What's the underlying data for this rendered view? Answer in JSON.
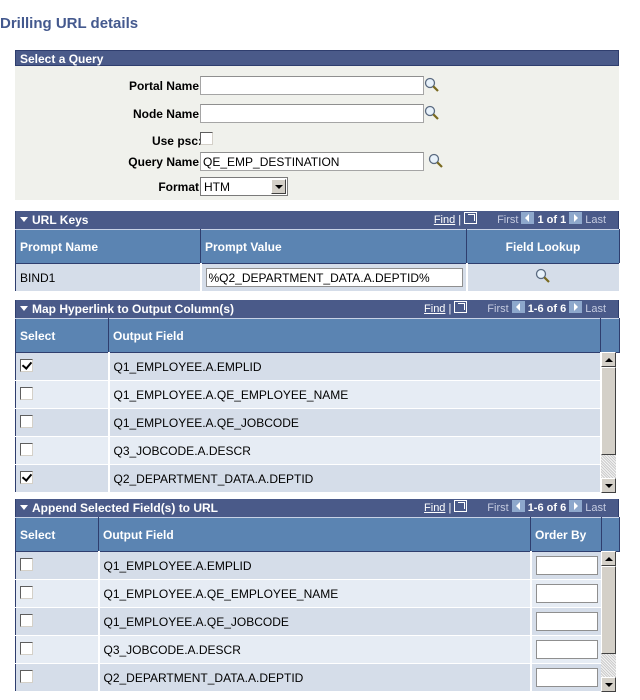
{
  "page": {
    "title": "Drilling URL details"
  },
  "query_panel": {
    "header": "Select a Query",
    "portal_name": {
      "label": "Portal Name",
      "value": ""
    },
    "node_name": {
      "label": "Node Name",
      "value": ""
    },
    "use_psc": {
      "label": "Use psc:",
      "checked": false
    },
    "query_name": {
      "label": "Query Name",
      "value": "QE_EMP_DESTINATION"
    },
    "format": {
      "label": "Format",
      "selected": "HTM"
    }
  },
  "url_keys": {
    "title": "URL Keys",
    "find": "Find",
    "first": "First",
    "count": "1 of 1",
    "last": "Last",
    "columns": [
      "Prompt Name",
      "Prompt Value",
      "Field Lookup"
    ],
    "rows": [
      {
        "prompt_name": "BIND1",
        "prompt_value": "%Q2_DEPARTMENT_DATA.A.DEPTID%",
        "lookup_icon": "search-icon"
      }
    ]
  },
  "map_hyperlink": {
    "title": "Map Hyperlink to Output Column(s)",
    "find": "Find",
    "first": "First",
    "count": "1-6 of 6",
    "last": "Last",
    "columns": [
      "Select",
      "Output Field"
    ],
    "rows": [
      {
        "selected": true,
        "field": "Q1_EMPLOYEE.A.EMPLID"
      },
      {
        "selected": false,
        "field": "Q1_EMPLOYEE.A.QE_EMPLOYEE_NAME"
      },
      {
        "selected": false,
        "field": "Q1_EMPLOYEE.A.QE_JOBCODE"
      },
      {
        "selected": false,
        "field": "Q3_JOBCODE.A.DESCR"
      },
      {
        "selected": true,
        "field": "Q2_DEPARTMENT_DATA.A.DEPTID"
      }
    ]
  },
  "append_fields": {
    "title": "Append Selected Field(s) to URL",
    "find": "Find",
    "first": "First",
    "count": "1-6 of 6",
    "last": "Last",
    "columns": [
      "Select",
      "Output Field",
      "Order By"
    ],
    "rows": [
      {
        "selected": false,
        "field": "Q1_EMPLOYEE.A.EMPLID",
        "order_by": ""
      },
      {
        "selected": false,
        "field": "Q1_EMPLOYEE.A.QE_EMPLOYEE_NAME",
        "order_by": ""
      },
      {
        "selected": false,
        "field": "Q1_EMPLOYEE.A.QE_JOBCODE",
        "order_by": ""
      },
      {
        "selected": false,
        "field": "Q3_JOBCODE.A.DESCR",
        "order_by": ""
      },
      {
        "selected": false,
        "field": "Q2_DEPARTMENT_DATA.A.DEPTID",
        "order_by": ""
      }
    ]
  }
}
